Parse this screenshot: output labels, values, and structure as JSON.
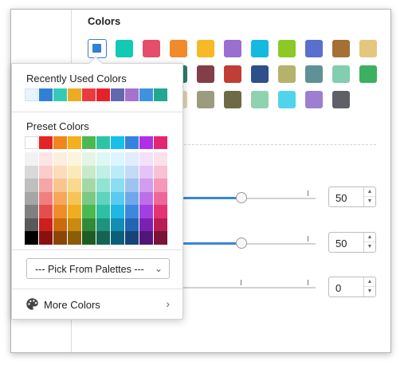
{
  "colors_section": {
    "title": "Colors",
    "selected_color": "#2f80d6",
    "row1": [
      "#12c9b4",
      "#e64d6a",
      "#f08a2b",
      "#f7b928",
      "#9a6fce",
      "#14b9e0",
      "#8bc926",
      "#5b6fcf",
      "#a47036",
      "#e4c67f"
    ],
    "row2": [
      "#2f7d6e",
      "#843e47",
      "#bf3f37",
      "#2d4f8a",
      "#b5b26d",
      "#5f9296",
      "#83cdb0",
      "#3bb061"
    ],
    "row3": [
      "#ded2b0",
      "#9c9b80",
      "#6e6a45",
      "#8fd2b0",
      "#4fd4eb",
      "#9e7ed0",
      "#5f5f68"
    ]
  },
  "sliders": [
    {
      "value": "50",
      "fill_fraction": 0.45
    },
    {
      "value": "50",
      "fill_fraction": 0.45
    },
    {
      "value": "0",
      "fill_fraction": 0
    }
  ],
  "popup": {
    "recent_title": "Recently Used Colors",
    "recent_colors": [
      "#e8f4fb",
      "#3180d6",
      "#36cab6",
      "#edab22",
      "#ea3b40",
      "#e52229",
      "#6367ad",
      "#a672cc",
      "#3e93de",
      "#21a890"
    ],
    "preset_title": "Preset Colors",
    "preset_top_row": [
      "#ffffff",
      "#e42424",
      "#f2851b",
      "#f2b01a",
      "#4cb852",
      "#2fc3a6",
      "#18c0e8",
      "#3583e1",
      "#b12ee8",
      "#e4266f"
    ],
    "preset_columns": [
      [
        "#f2f2f2",
        "#d9d9d9",
        "#bfbfbf",
        "#a6a6a6",
        "#808080",
        "#595959",
        "#000000"
      ],
      [
        "#fde5e5",
        "#facccc",
        "#f5a6a6",
        "#f08080",
        "#e64d4d",
        "#cc1f1f",
        "#8a1010"
      ],
      [
        "#fdeedd",
        "#fcdcbb",
        "#f9c58c",
        "#f5a85a",
        "#ef8c2b",
        "#cc6a0f",
        "#8a4508"
      ],
      [
        "#fdf4dd",
        "#fce9bb",
        "#f9d98c",
        "#f5c55a",
        "#efae22",
        "#c98a10",
        "#8a5d08"
      ],
      [
        "#e4f4e5",
        "#c9e9cb",
        "#a4d9a7",
        "#7cc981",
        "#4cb852",
        "#318a36",
        "#1f5c23"
      ],
      [
        "#dff7f2",
        "#bfefe5",
        "#92e3d2",
        "#5fd3bb",
        "#2fbfa3",
        "#1f937c",
        "#146353"
      ],
      [
        "#ddf5fc",
        "#bbebf9",
        "#8cdcf4",
        "#5acbee",
        "#1fb7e4",
        "#128db3",
        "#0b6079"
      ],
      [
        "#e1edfb",
        "#c3dbf7",
        "#9cc3f1",
        "#6fa8ea",
        "#3e88dc",
        "#2165b3",
        "#164479"
      ],
      [
        "#f2e1fb",
        "#e5c3f7",
        "#d29cf1",
        "#bd6fea",
        "#a33ee0",
        "#7a21b3",
        "#521679"
      ],
      [
        "#fce0ea",
        "#f9c1d5",
        "#f497b8",
        "#ee6897",
        "#e33471",
        "#b81d53",
        "#7a1337"
      ]
    ],
    "palette_dropdown_label": "--- Pick From Palettes ---",
    "more_colors_label": "More Colors"
  }
}
